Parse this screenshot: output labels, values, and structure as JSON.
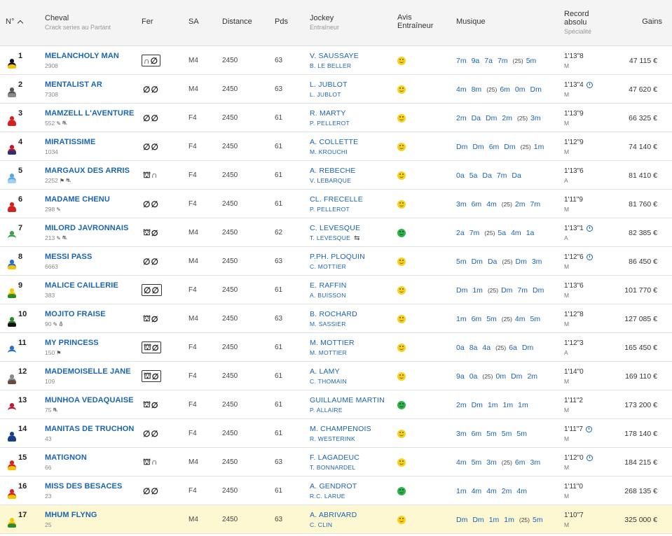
{
  "headers": {
    "num": "N°",
    "sort_icon": "chevron-up-icon",
    "cheval": "Cheval",
    "cheval_sub": "Crack series au Partant",
    "fer": "Fer",
    "sa": "SA",
    "distance": "Distance",
    "pds": "Pds",
    "jockey": "Jockey",
    "jockey_sub": "Entraîneur",
    "avis1": "Avis",
    "avis2": "Entraîneur",
    "musique": "Musique",
    "record1": "Record",
    "record2": "absolu",
    "record_sub": "Spécialité",
    "gains": "Gains"
  },
  "colors": {
    "link": "#1a64b4",
    "highlight_row": "#fdf8d2",
    "smiley_yellow": "#f7d21c",
    "smiley_green": "#2eb24b"
  },
  "rows": [
    {
      "num": "1",
      "jacket": [
        "#f2c500",
        "#111111"
      ],
      "name": "MELANCHOLY MAN",
      "sub": "2908",
      "tags": [],
      "fer": "∩∅",
      "fer_boxed": true,
      "sa": "M4",
      "dist": "2450",
      "pds": "63",
      "jockey": "V. SAUSSAYE",
      "trainer": "B. LE BELLER",
      "swap": false,
      "avis": "y",
      "mus": [
        "7m",
        "9a",
        "7a",
        "7m",
        "(25)",
        "5m"
      ],
      "rec": "1'13\"8",
      "clock": false,
      "spec": "M",
      "gains": "47 115 €",
      "hl": false
    },
    {
      "num": "2",
      "jacket": [
        "#8a8a8a",
        "#555555"
      ],
      "name": "MENTALIST AR",
      "sub": "7308",
      "tags": [],
      "fer": "∅∅",
      "fer_boxed": false,
      "sa": "M4",
      "dist": "2450",
      "pds": "63",
      "jockey": "L. JUBLOT",
      "trainer": "L. JUBLOT",
      "swap": false,
      "avis": "y",
      "mus": [
        "4m",
        "8m",
        "(25)",
        "6m",
        "0m",
        "Dm"
      ],
      "rec": "1'13\"4",
      "clock": true,
      "spec": "M",
      "gains": "47 620 €",
      "hl": false
    },
    {
      "num": "3",
      "jacket": [
        "#d62020",
        "#d62020"
      ],
      "name": "MAMZELL L'AVENTURE",
      "sub": "552",
      "tags": [
        "✎",
        "⛐"
      ],
      "fer": "∅∅",
      "fer_boxed": false,
      "sa": "F4",
      "dist": "2450",
      "pds": "61",
      "jockey": "R. MARTY",
      "trainer": "P. PELLEROT",
      "swap": false,
      "avis": "y",
      "mus": [
        "2m",
        "Da",
        "Dm",
        "2m",
        "(25)",
        "3m"
      ],
      "rec": "1'13\"9",
      "clock": false,
      "spec": "M",
      "gains": "66 325 €",
      "hl": false
    },
    {
      "num": "4",
      "jacket": [
        "#2a2f7a",
        "#c0182a"
      ],
      "name": "MIRATISSIME",
      "sub": "1034",
      "tags": [],
      "fer": "∅∅",
      "fer_boxed": false,
      "sa": "F4",
      "dist": "2450",
      "pds": "61",
      "jockey": "A. COLLETTE",
      "trainer": "M. KROUCHI",
      "swap": false,
      "avis": "y",
      "mus": [
        "Dm",
        "Dm",
        "6m",
        "Dm",
        "(25)",
        "1m"
      ],
      "rec": "1'12\"9",
      "clock": false,
      "spec": "M",
      "gains": "74 140 €",
      "hl": false
    },
    {
      "num": "5",
      "jacket": [
        "#9fd0ee",
        "#5aa9dd"
      ],
      "name": "MARGAUX DES ARRIS",
      "sub": "2252",
      "tags": [
        "⚑",
        "⛐"
      ],
      "fer": "⛫∩",
      "fer_boxed": false,
      "sa": "F4",
      "dist": "2450",
      "pds": "61",
      "jockey": "A. REBECHE",
      "trainer": "V. LEBARQUE",
      "swap": false,
      "avis": "y",
      "mus": [
        "0a",
        "5a",
        "Da",
        "7m",
        "Da"
      ],
      "rec": "1'13\"6",
      "clock": false,
      "spec": "A",
      "gains": "81 410 €",
      "hl": false
    },
    {
      "num": "6",
      "jacket": [
        "#d62020",
        "#d62020"
      ],
      "name": "MADAME CHENU",
      "sub": "298",
      "tags": [
        "✎"
      ],
      "fer": "∅∅",
      "fer_boxed": false,
      "sa": "F4",
      "dist": "2450",
      "pds": "61",
      "jockey": "CL. FRECELLE",
      "trainer": "P. PELLEROT",
      "swap": false,
      "avis": "y",
      "mus": [
        "3m",
        "6m",
        "4m",
        "(25)",
        "2m",
        "7m"
      ],
      "rec": "1'11\"9",
      "clock": false,
      "spec": "M",
      "gains": "81 760 €",
      "hl": false
    },
    {
      "num": "7",
      "jacket": [
        "#ffffff",
        "#3aa04a"
      ],
      "name": "MILORD JAVRONNAIS",
      "sub": "213",
      "tags": [
        "✎",
        "⛐"
      ],
      "fer": "⛫∅",
      "fer_boxed": false,
      "sa": "M4",
      "dist": "2450",
      "pds": "62",
      "jockey": "C. LEVESQUE",
      "trainer": "T. LEVESQUE",
      "swap": true,
      "avis": "g",
      "mus": [
        "2a",
        "7m",
        "(25)",
        "5a",
        "4m",
        "1a"
      ],
      "rec": "1'13\"1",
      "clock": true,
      "spec": "A",
      "gains": "82 385 €",
      "hl": false
    },
    {
      "num": "8",
      "jacket": [
        "#f2c500",
        "#2a6fc9"
      ],
      "name": "MESSI PASS",
      "sub": "6663",
      "tags": [],
      "fer": "∅∅",
      "fer_boxed": false,
      "sa": "M4",
      "dist": "2450",
      "pds": "63",
      "jockey": "P.PH. PLOQUIN",
      "trainer": "C. MOTTIER",
      "swap": false,
      "avis": "y",
      "mus": [
        "5m",
        "Dm",
        "Da",
        "(25)",
        "Dm",
        "3m"
      ],
      "rec": "1'12\"6",
      "clock": true,
      "spec": "M",
      "gains": "86 450 €",
      "hl": false
    },
    {
      "num": "9",
      "jacket": [
        "#2a8a2a",
        "#f2c500"
      ],
      "name": "MALICE CAILLERIE",
      "sub": "383",
      "tags": [],
      "fer": "∅∅",
      "fer_boxed": true,
      "sa": "F4",
      "dist": "2450",
      "pds": "61",
      "jockey": "E. RAFFIN",
      "trainer": "A. BUISSON",
      "swap": false,
      "avis": "y",
      "mus": [
        "Dm",
        "1m",
        "(25)",
        "Dm",
        "7m",
        "Dm"
      ],
      "rec": "1'13\"6",
      "clock": false,
      "spec": "M",
      "gains": "101 770 €",
      "hl": false
    },
    {
      "num": "10",
      "jacket": [
        "#111111",
        "#2a8a2a"
      ],
      "name": "MOJITO FRAISE",
      "sub": "90",
      "tags": [
        "✎",
        "⛢"
      ],
      "fer": "⛫∅",
      "fer_boxed": false,
      "sa": "M4",
      "dist": "2450",
      "pds": "63",
      "jockey": "B. ROCHARD",
      "trainer": "M. SASSIER",
      "swap": false,
      "avis": "y",
      "mus": [
        "1m",
        "6m",
        "5m",
        "(25)",
        "4m",
        "5m"
      ],
      "rec": "1'12\"8",
      "clock": false,
      "spec": "M",
      "gains": "127 085 €",
      "hl": false
    },
    {
      "num": "11",
      "jacket": [
        "#ffffff",
        "#2a6fc9"
      ],
      "name": "MY PRINCESS",
      "sub": "150",
      "tags": [
        "⚑"
      ],
      "fer": "⛫∅",
      "fer_boxed": true,
      "sa": "F4",
      "dist": "2450",
      "pds": "61",
      "jockey": "M. MOTTIER",
      "trainer": "M. MOTTIER",
      "swap": false,
      "avis": "y",
      "mus": [
        "0a",
        "8a",
        "4a",
        "(25)",
        "6a",
        "Dm"
      ],
      "rec": "1'12\"3",
      "clock": false,
      "spec": "A",
      "gains": "165 450 €",
      "hl": false
    },
    {
      "num": "12",
      "jacket": [
        "#6a4a3a",
        "#888888"
      ],
      "name": "MADEMOISELLE JANE",
      "sub": "109",
      "tags": [],
      "fer": "⛫∅",
      "fer_boxed": true,
      "sa": "F4",
      "dist": "2450",
      "pds": "61",
      "jockey": "A. LAMY",
      "trainer": "C. THOMAIN",
      "swap": false,
      "avis": "y",
      "mus": [
        "9a",
        "0a",
        "(25)",
        "0m",
        "Dm",
        "2m"
      ],
      "rec": "1'14\"0",
      "clock": false,
      "spec": "M",
      "gains": "169 110 €",
      "hl": false
    },
    {
      "num": "13",
      "jacket": [
        "#ffffff",
        "#c0182a"
      ],
      "name": "MUNHOA VEDAQUAISE",
      "sub": "75",
      "tags": [
        "⛐"
      ],
      "fer": "⛫∅",
      "fer_boxed": false,
      "sa": "F4",
      "dist": "2450",
      "pds": "61",
      "jockey": "GUILLAUME MARTIN",
      "trainer": "P. ALLAIRE",
      "swap": false,
      "avis": "g",
      "mus": [
        "2m",
        "Dm",
        "1m",
        "1m",
        "1m"
      ],
      "rec": "1'11\"2",
      "clock": false,
      "spec": "M",
      "gains": "173 200 €",
      "hl": false
    },
    {
      "num": "14",
      "jacket": [
        "#1a3f8a",
        "#1a3f8a"
      ],
      "name": "MANITAS DE TRUCHON",
      "sub": "43",
      "tags": [],
      "fer": "∅∅",
      "fer_boxed": false,
      "sa": "F4",
      "dist": "2450",
      "pds": "61",
      "jockey": "M. CHAMPENOIS",
      "trainer": "R. WESTERINK",
      "swap": false,
      "avis": "y",
      "mus": [
        "3m",
        "6m",
        "5m",
        "5m",
        "5m"
      ],
      "rec": "1'11\"7",
      "clock": true,
      "spec": "M",
      "gains": "178 140 €",
      "hl": false
    },
    {
      "num": "15",
      "jacket": [
        "#f2c500",
        "#d62020"
      ],
      "name": "MATIGNON",
      "sub": "66",
      "tags": [],
      "fer": "⛫∩",
      "fer_boxed": false,
      "sa": "M4",
      "dist": "2450",
      "pds": "63",
      "jockey": "F. LAGADEUC",
      "trainer": "T. BONNARDEL",
      "swap": false,
      "avis": "y",
      "mus": [
        "4m",
        "5m",
        "3m",
        "(25)",
        "6m",
        "3m"
      ],
      "rec": "1'12\"0",
      "clock": true,
      "spec": "M",
      "gains": "184 215 €",
      "hl": false
    },
    {
      "num": "16",
      "jacket": [
        "#f2c500",
        "#d62020"
      ],
      "name": "MISS DES BESACES",
      "sub": "23",
      "tags": [],
      "fer": "∅∅",
      "fer_boxed": false,
      "sa": "F4",
      "dist": "2450",
      "pds": "61",
      "jockey": "A. GENDROT",
      "trainer": "R.C. LARUE",
      "swap": false,
      "avis": "g",
      "mus": [
        "1m",
        "4m",
        "4m",
        "2m",
        "4m"
      ],
      "rec": "1'11\"0",
      "clock": false,
      "spec": "M",
      "gains": "268 135 €",
      "hl": false
    },
    {
      "num": "17",
      "jacket": [
        "#2a8a2a",
        "#f2c500"
      ],
      "name": "MHUM FLYNG",
      "sub": "25",
      "tags": [],
      "fer": "",
      "fer_boxed": false,
      "sa": "M4",
      "dist": "2450",
      "pds": "63",
      "jockey": "A. ABRIVARD",
      "trainer": "C. CLIN",
      "swap": false,
      "avis": "y",
      "mus": [
        "Dm",
        "Dm",
        "1m",
        "1m",
        "(25)",
        "5m"
      ],
      "rec": "1'10\"7",
      "clock": false,
      "spec": "M",
      "gains": "325 000 €",
      "hl": true
    }
  ]
}
